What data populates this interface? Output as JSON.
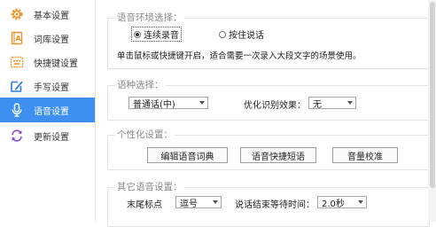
{
  "sidebar": {
    "items": [
      {
        "label": "基本设置",
        "icon": "gear-icon"
      },
      {
        "label": "词库设置",
        "icon": "dictionary-icon"
      },
      {
        "label": "快捷键设置",
        "icon": "keyboard-icon"
      },
      {
        "label": "手写设置",
        "icon": "handwriting-icon"
      },
      {
        "label": "语音设置",
        "icon": "microphone-icon",
        "active": true
      },
      {
        "label": "更新设置",
        "icon": "refresh-icon"
      }
    ],
    "active_color": "#3d8ff0"
  },
  "env": {
    "title": "语音环境选择：",
    "option_continuous": "连续录音",
    "option_press": "按住说话",
    "selected": "连续录音",
    "description": "单击鼠标或快捷键开启，适合需要一次录入大段文字的场景使用。"
  },
  "lang": {
    "title": "语种选择：",
    "value": "普通话(中)",
    "optimize_label": "优化识别效果：",
    "optimize_value": "无"
  },
  "personal": {
    "title": "个性化设置：",
    "btn_dict": "编辑语音词典",
    "btn_phrase": "语音快捷短语",
    "btn_volume": "音量校准"
  },
  "other": {
    "title": "其它语音设置：",
    "punct_label": "末尾标点",
    "punct_value": "逗号",
    "wait_label": "说话结束等待时间：",
    "wait_value": "2.0秒"
  }
}
